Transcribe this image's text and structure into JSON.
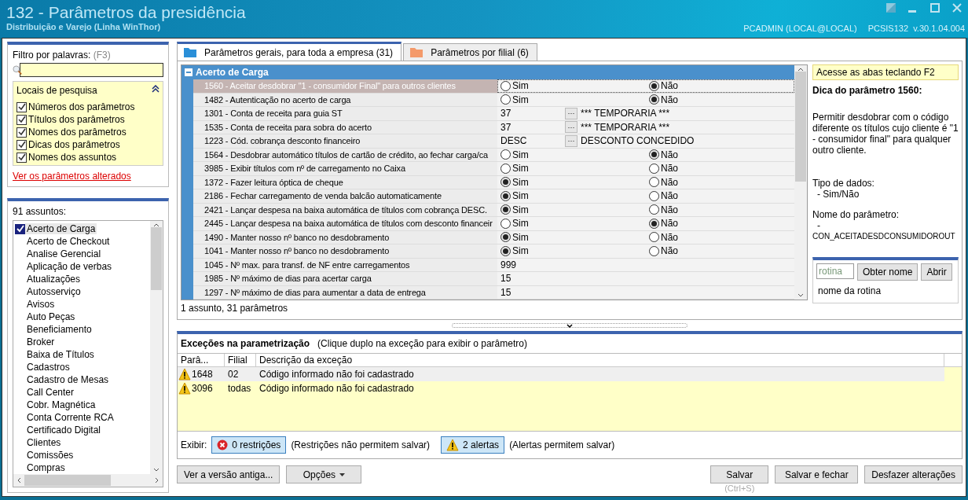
{
  "window": {
    "title": "132 - Parâmetros da presidência",
    "subtitle": "Distribuição e Varejo (Linha WinThor)",
    "user": "PCADMIN (LOCAL@LOCAL)",
    "version": "PCSIS132  v.30.1.04.004"
  },
  "filter": {
    "label": "Filtro por palavras:",
    "shortcut": "(F3)",
    "places_title": "Locais de pesquisa",
    "places": [
      {
        "label": "Números dos parâmetros",
        "checked": true
      },
      {
        "label": "Títulos dos parâmetros",
        "checked": true
      },
      {
        "label": "Nomes dos parâmetros",
        "checked": true
      },
      {
        "label": "Dicas dos parâmetros",
        "checked": true
      },
      {
        "label": "Nomes dos assuntos",
        "checked": true
      }
    ],
    "changed_link": "Ver os parâmetros alterados"
  },
  "subjects": {
    "count_label": "91 assuntos:",
    "items": [
      {
        "label": "Acerto de Carga",
        "selected": true,
        "checked": true
      },
      {
        "label": "Acerto de Checkout",
        "selected": false,
        "checked": false
      },
      {
        "label": "Analise Gerencial",
        "selected": false,
        "checked": false
      },
      {
        "label": "Aplicação de verbas",
        "selected": false,
        "checked": false
      },
      {
        "label": "Atualizações",
        "selected": false,
        "checked": false
      },
      {
        "label": "Autosserviço",
        "selected": false,
        "checked": false
      },
      {
        "label": "Avisos",
        "selected": false,
        "checked": false
      },
      {
        "label": "Auto Peças",
        "selected": false,
        "checked": false
      },
      {
        "label": "Beneficiamento",
        "selected": false,
        "checked": false
      },
      {
        "label": "Broker",
        "selected": false,
        "checked": false
      },
      {
        "label": "Baixa de Títulos",
        "selected": false,
        "checked": false
      },
      {
        "label": "Cadastros",
        "selected": false,
        "checked": false
      },
      {
        "label": "Cadastro de Mesas",
        "selected": false,
        "checked": false
      },
      {
        "label": "Call Center",
        "selected": false,
        "checked": false
      },
      {
        "label": "Cobr. Magnética",
        "selected": false,
        "checked": false
      },
      {
        "label": "Conta Corrente RCA",
        "selected": false,
        "checked": false
      },
      {
        "label": "Certificado Digital",
        "selected": false,
        "checked": false
      },
      {
        "label": "Clientes",
        "selected": false,
        "checked": false
      },
      {
        "label": "Comissões",
        "selected": false,
        "checked": false
      },
      {
        "label": "Compras",
        "selected": false,
        "checked": false
      }
    ]
  },
  "tabs": [
    {
      "label": "Parâmetros gerais, para toda a empresa  (31)",
      "selected": true
    },
    {
      "label": "Parâmetros por filial  (6)",
      "selected": false
    }
  ],
  "params": {
    "group": "Acerto de Carga",
    "footer": "1 assunto, 31 parâmetros",
    "rows": [
      {
        "kind": "choice",
        "title": "1560 - Aceitar desdobrar \"1 - consumidor Final\" para outros clientes",
        "selected": true,
        "options": [
          {
            "label": "Sim",
            "selected": false
          },
          {
            "label": "Não",
            "selected": true
          }
        ]
      },
      {
        "kind": "choice",
        "title": "1482 - Autenticação no acerto de carga",
        "selected": false,
        "options": [
          {
            "label": "Sim",
            "selected": false
          },
          {
            "label": "Não",
            "selected": true
          }
        ]
      },
      {
        "kind": "lookup",
        "title": "1301 - Conta de receita para guia ST",
        "selected": false,
        "value": "37",
        "button": "···",
        "description": "*** TEMPORARIA ***"
      },
      {
        "kind": "lookup",
        "title": "1535 - Conta de receita para sobra do acerto",
        "selected": false,
        "value": "37",
        "button": "···",
        "description": "*** TEMPORARIA ***"
      },
      {
        "kind": "lookup",
        "title": "1223 - Cód. cobrança desconto financeiro",
        "selected": false,
        "value": "DESC",
        "button": "···",
        "description": "DESCONTO CONCEDIDO"
      },
      {
        "kind": "choice",
        "title": "1564 - Desdobrar automático títulos de cartão de crédito, ao fechar carga/ca",
        "selected": false,
        "options": [
          {
            "label": "Sim",
            "selected": false
          },
          {
            "label": "Não",
            "selected": true
          }
        ]
      },
      {
        "kind": "choice",
        "title": "3985 - Exibir títulos com nº de carregamento no Caixa",
        "selected": false,
        "options": [
          {
            "label": "Sim",
            "selected": false
          },
          {
            "label": "Não",
            "selected": false
          }
        ]
      },
      {
        "kind": "choice",
        "title": "1372 - Fazer leitura óptica de cheque",
        "selected": false,
        "options": [
          {
            "label": "Sim",
            "selected": true
          },
          {
            "label": "Não",
            "selected": false
          }
        ]
      },
      {
        "kind": "choice",
        "title": "2186 - Fechar carregamento de venda balcão automaticamente",
        "selected": false,
        "options": [
          {
            "label": "Sim",
            "selected": true
          },
          {
            "label": "Não",
            "selected": false
          }
        ]
      },
      {
        "kind": "choice",
        "title": "2421 - Lançar despesa na baixa automática de títulos com cobrança DESC.",
        "selected": false,
        "options": [
          {
            "label": "Sim",
            "selected": true
          },
          {
            "label": "Não",
            "selected": false
          }
        ]
      },
      {
        "kind": "choice",
        "title": "2445 - Lançar despesa na baixa automática de títulos com desconto financeir",
        "selected": false,
        "options": [
          {
            "label": "Sim",
            "selected": false
          },
          {
            "label": "Não",
            "selected": true
          }
        ]
      },
      {
        "kind": "choice",
        "title": "1490 - Manter nosso nº banco no desdobramento",
        "selected": false,
        "options": [
          {
            "label": "Sim",
            "selected": true
          },
          {
            "label": "Não",
            "selected": false
          }
        ]
      },
      {
        "kind": "choice",
        "title": "1041 - Manter nosso nº banco no desdobramento",
        "selected": false,
        "options": [
          {
            "label": "Sim",
            "selected": true
          },
          {
            "label": "Não",
            "selected": false
          }
        ]
      },
      {
        "kind": "text",
        "title": "1045 - Nº max. para transf. de NF entre carregamentos",
        "selected": false,
        "value": "999"
      },
      {
        "kind": "text",
        "title": "1985 - Nº máximo de dias para acertar carga",
        "selected": false,
        "value": "15"
      },
      {
        "kind": "text",
        "title": "1297 - Nº máximo de dias para aumentar a data de entrega",
        "selected": false,
        "value": "15"
      }
    ]
  },
  "hint": {
    "access": "Acesse as abas teclando F2",
    "title": "Dica do parâmetro 1560:",
    "text": "Permitir desdobrar com o código diferente os títulos cujo cliente é \"1 - consumidor final\" para qualquer outro cliente.",
    "type_label": "Tipo de dados:",
    "type": "- Sim/Não",
    "name_label": "Nome do parâmetro:",
    "name_dash": "-",
    "name": "CON_ACEITADESDCONSUMIDOROUT"
  },
  "routine": {
    "placeholder": "rotina",
    "buttons": [
      "Obter nome",
      "Abrir"
    ],
    "caption": "nome da rotina"
  },
  "exceptions": {
    "title": "Exceções na parametrização",
    "note": "(Clique duplo na exceção para exibir o parâmetro)",
    "columns": [
      "Parâ...",
      "Filial",
      "Descrição da exceção"
    ],
    "rows": [
      {
        "param": "1648",
        "branch": "02",
        "description": "Código informado não foi cadastrado",
        "selected": true
      },
      {
        "param": "3096",
        "branch": "todas",
        "description": "Código informado não foi cadastrado",
        "selected": false
      }
    ],
    "show_label": "Exibir:",
    "filters": [
      {
        "kind": "error",
        "label": "0 restrições",
        "note": "(Restrições não permitem salvar)"
      },
      {
        "kind": "warning",
        "label": "2 alertas",
        "note": "(Alertas permitem salvar)"
      }
    ]
  },
  "actions": {
    "left": [
      {
        "label": "Ver a versão antiga...",
        "kind": "plain"
      },
      {
        "label": "Opções",
        "kind": "menu"
      }
    ],
    "right": [
      {
        "label": "Salvar",
        "shortcut": "(Ctrl+S)"
      },
      {
        "label": "Salvar e fechar"
      },
      {
        "label": "Desfazer alterações"
      }
    ]
  }
}
